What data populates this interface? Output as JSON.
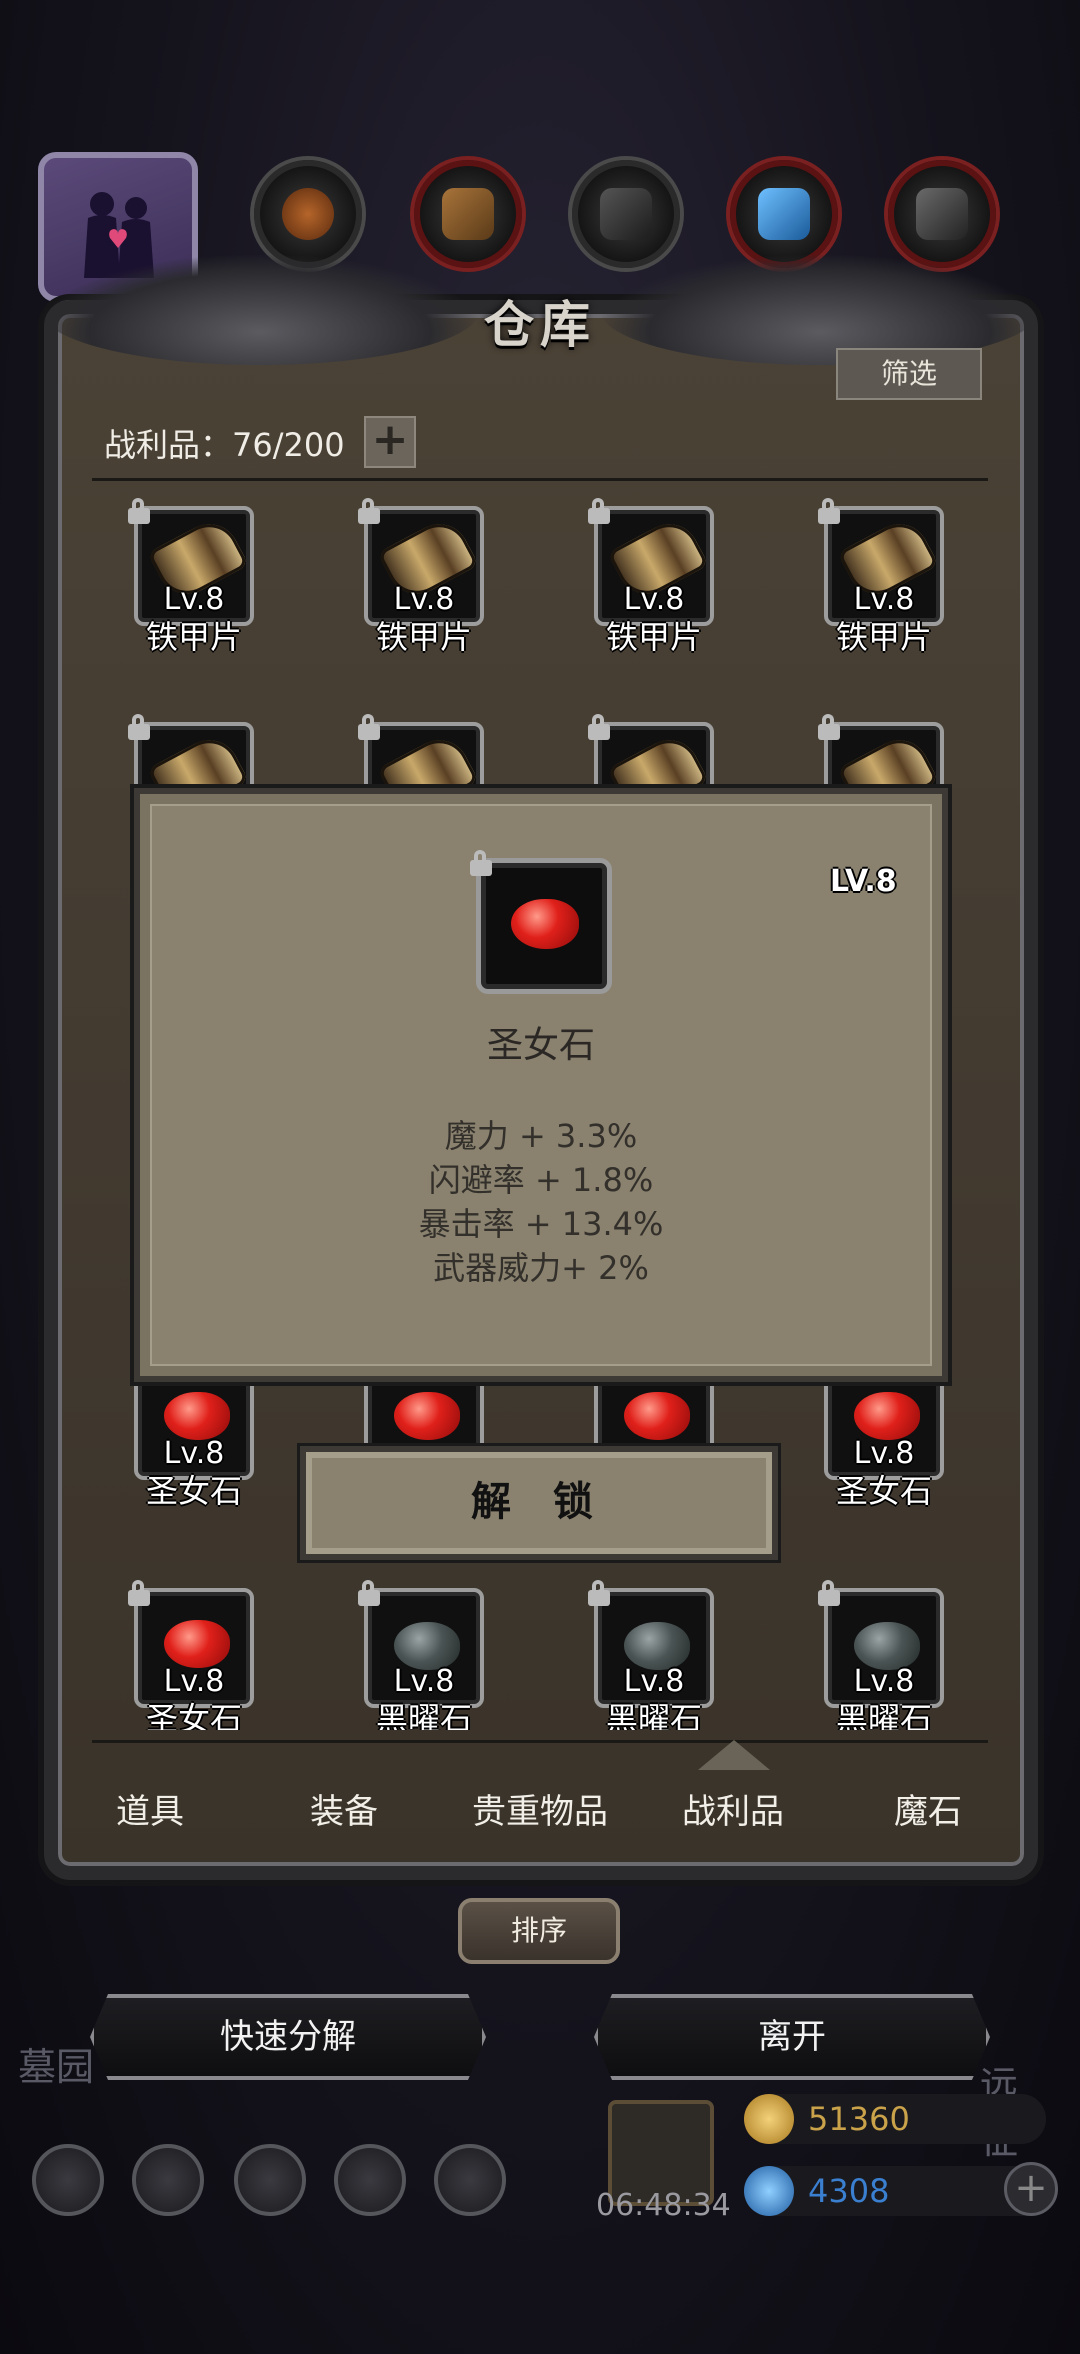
{
  "storage": {
    "title": "仓库",
    "filter_label": "筛选",
    "count_label": "战利品：76/200",
    "plus_label": "+"
  },
  "grid_rows": [
    [
      {
        "level": "Lv.8",
        "name": "铁甲片",
        "icon": "iron-armor-piece"
      },
      {
        "level": "Lv.8",
        "name": "铁甲片",
        "icon": "iron-armor-piece"
      },
      {
        "level": "Lv.8",
        "name": "铁甲片",
        "icon": "iron-armor-piece"
      },
      {
        "level": "Lv.8",
        "name": "铁甲片",
        "icon": "iron-armor-piece"
      }
    ],
    [
      {
        "level": "Lv.8",
        "name": "圣女石",
        "icon": "red-gem"
      },
      {
        "level": "",
        "name": "",
        "icon": "red-gem"
      },
      {
        "level": "",
        "name": "",
        "icon": "red-gem"
      },
      {
        "level": "Lv.8",
        "name": "圣女石",
        "icon": "red-gem"
      }
    ],
    [
      {
        "level": "Lv.8",
        "name": "圣女石",
        "icon": "red-gem"
      },
      {
        "level": "Lv.8",
        "name": "黑曜石",
        "icon": "black-gem"
      },
      {
        "level": "Lv.8",
        "name": "黑曜石",
        "icon": "black-gem"
      },
      {
        "level": "Lv.8",
        "name": "黑曜石",
        "icon": "black-gem"
      }
    ]
  ],
  "tabs": [
    "道具",
    "装备",
    "贵重物品",
    "战利品",
    "魔石"
  ],
  "active_tab": "战利品",
  "sort_label": "排序",
  "buttons": {
    "quick_decompose": "快速分解",
    "leave": "离开"
  },
  "background": {
    "left_word": "墓园",
    "right_word": "远征"
  },
  "hud": {
    "timer": "06:48:34",
    "gold": "51360",
    "gems": "4308"
  },
  "popup": {
    "level": "LV.8",
    "item_name": "圣女石",
    "stats": [
      "魔力 + 3.3%",
      "闪避率 + 1.8%",
      "暴击率 + 13.4%",
      "武器威力+ 2%"
    ],
    "unlock_label": "解 锁"
  },
  "colors": {
    "panel": "#3a332a",
    "popup_bg": "#8a826f",
    "gem_red": "#e0201a",
    "gold": "#c9a24a",
    "blue": "#3a7fd0"
  }
}
